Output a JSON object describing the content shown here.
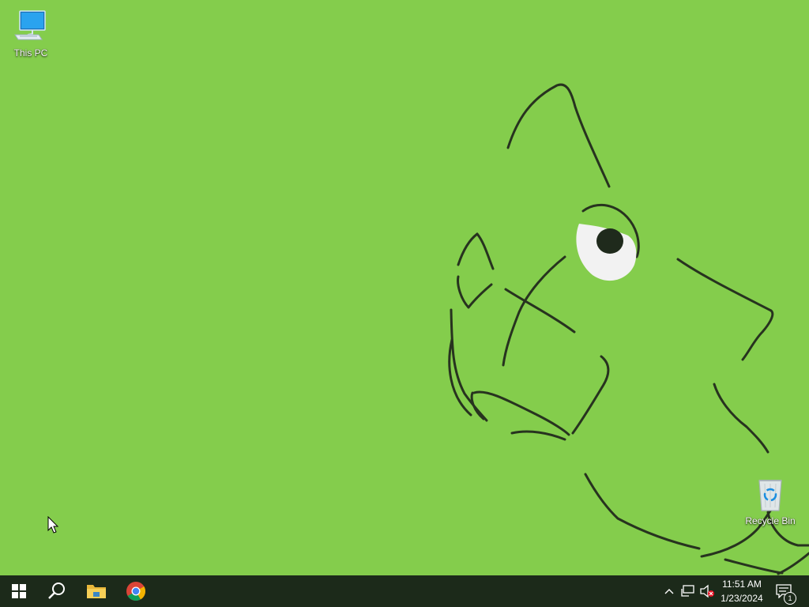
{
  "desktop": {
    "icons": [
      {
        "label": "This PC",
        "icon": "this-pc-icon"
      },
      {
        "label": "Recycle Bin",
        "icon": "recycle-bin-icon"
      }
    ],
    "wallpaper_color": "#84cd4c"
  },
  "taskbar": {
    "pinned": [
      {
        "name": "start",
        "icon": "windows-logo-icon"
      },
      {
        "name": "search",
        "icon": "search-icon"
      },
      {
        "name": "file-explorer",
        "icon": "folder-icon"
      },
      {
        "name": "chrome",
        "icon": "chrome-icon"
      }
    ],
    "tray": {
      "icons": [
        "chevron-up-icon",
        "network-icon",
        "volume-muted-icon"
      ],
      "time": "11:51 AM",
      "date": "1/23/2024",
      "notifications_count": "1"
    }
  },
  "colors": {
    "taskbar": "#1c2a1a",
    "accent": "#84cd4c"
  }
}
